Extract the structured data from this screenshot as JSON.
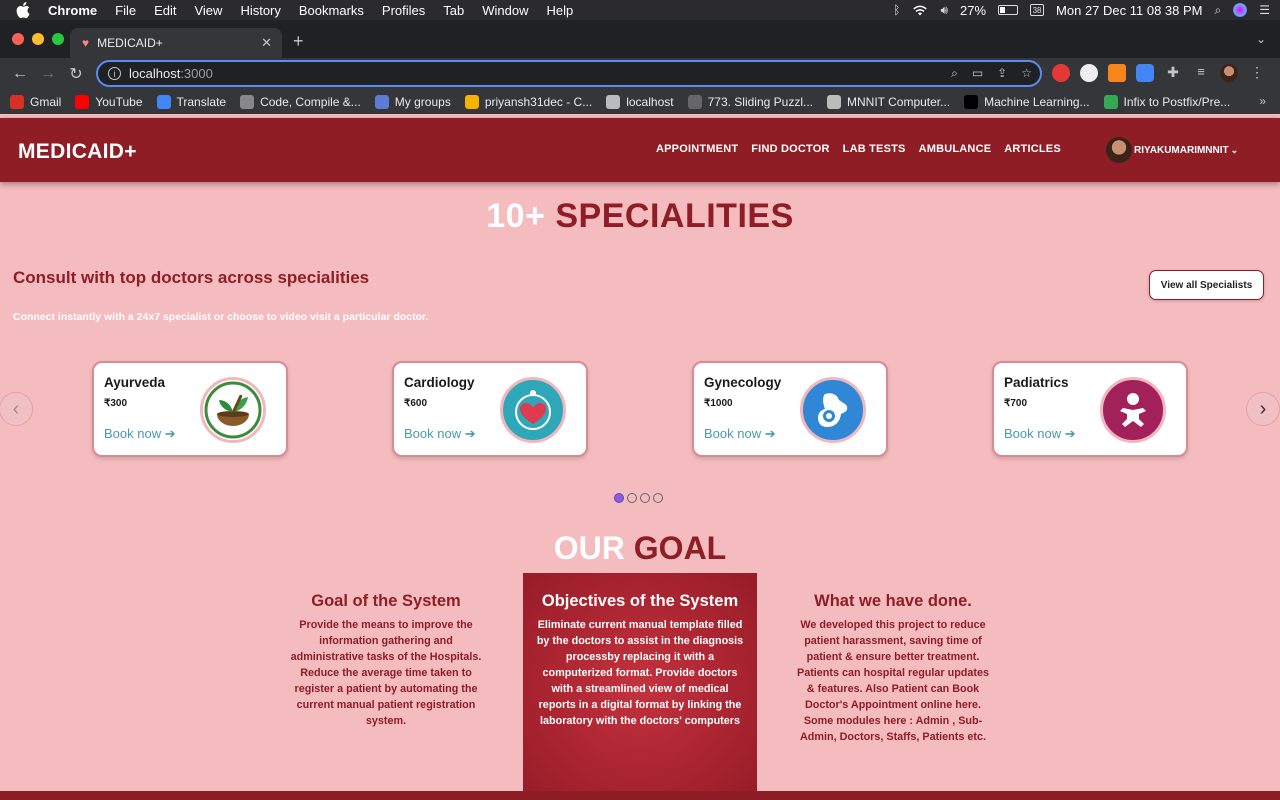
{
  "menubar": {
    "app": "Chrome",
    "items": [
      "File",
      "Edit",
      "View",
      "History",
      "Bookmarks",
      "Profiles",
      "Tab",
      "Window",
      "Help"
    ],
    "battery": "27%",
    "datetime": "Mon 27 Dec  11 08 38 PM"
  },
  "tab": {
    "title": "MEDICAID+"
  },
  "address": {
    "host": "localhost",
    "port": ":3000"
  },
  "bookmarks": [
    {
      "label": "Gmail",
      "color": "#d93025"
    },
    {
      "label": "YouTube",
      "color": "#ff0000"
    },
    {
      "label": "Translate",
      "color": "#4285f4"
    },
    {
      "label": "Code, Compile &...",
      "color": "#888888"
    },
    {
      "label": "My groups",
      "color": "#5b7bd5"
    },
    {
      "label": "priyansh31dec - C...",
      "color": "#f4b400"
    },
    {
      "label": "localhost",
      "color": "#bbbbbb"
    },
    {
      "label": "773. Sliding Puzzl...",
      "color": "#666666"
    },
    {
      "label": "MNNIT Computer...",
      "color": "#bbbbbb"
    },
    {
      "label": "Machine Learning...",
      "color": "#000000"
    },
    {
      "label": "Infix to Postfix/Pre...",
      "color": "#34a853"
    }
  ],
  "site": {
    "brand": "MEDICAID+",
    "nav": [
      "APPOINTMENT",
      "FIND DOCTOR",
      "LAB TESTS",
      "AMBULANCE",
      "ARTICLES"
    ],
    "user": "RIYAKUMARIMNNIT"
  },
  "specialities": {
    "title_white": "10+",
    "title_red": "SPECIALITIES",
    "heading": "Consult with top doctors across specialities",
    "view_all": "View all Specialists",
    "subtext": "Connect instantly with a 24x7 specialist or choose to video visit a particular doctor.",
    "cards": [
      {
        "name": "Ayurveda",
        "price": "₹300",
        "cta": "Book now ➔",
        "icon": "herbal-bowl-icon"
      },
      {
        "name": "Cardiology",
        "price": "₹600",
        "cta": "Book now ➔",
        "icon": "heart-stethoscope-icon"
      },
      {
        "name": "Gynecology",
        "price": "₹1000",
        "cta": "Book now ➔",
        "icon": "pregnancy-icon"
      },
      {
        "name": "Padiatrics",
        "price": "₹700",
        "cta": "Book now ➔",
        "icon": "baby-icon"
      }
    ],
    "arrow_prev": "‹",
    "arrow_next": "›",
    "pages": 4,
    "active_page": 1
  },
  "goal": {
    "title_white": "OUR",
    "title_red": "GOAL",
    "columns": [
      {
        "heading": "Goal of the System",
        "text": "Provide the means to improve the information gathering and administrative tasks of the Hospitals. Reduce the average time taken to register a patient by automating the current manual patient registration system."
      },
      {
        "heading": "Objectives of the System",
        "text": "Eliminate current manual template filled by the doctors to assist in the diagnosis processby replacing it with a computerized format. Provide doctors with a streamlined view of medical reports in a digital format by linking the laboratory with the doctors' computers"
      },
      {
        "heading": "What we have done.",
        "text": "We developed this project to reduce patient harassment, saving time of patient & ensure better treatment. Patients can hospital regular updates & features. Also Patient can Book Doctor's Appointment online here. Some modules here : Admin , Sub-Admin, Doctors, Staffs, Patients etc."
      }
    ]
  },
  "colors": {
    "brand": "#8f1d25",
    "page_bg": "#f5bcbf",
    "link": "#4a9aad"
  }
}
